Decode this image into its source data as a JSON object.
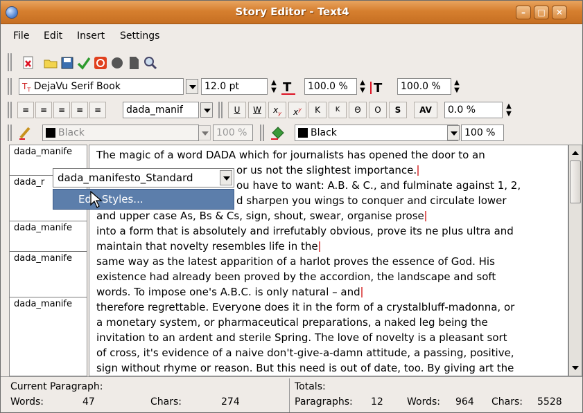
{
  "window": {
    "title": "Story Editor - Text4"
  },
  "menubar": {
    "items": [
      "File",
      "Edit",
      "Insert",
      "Settings"
    ]
  },
  "font_bar": {
    "font": "DejaVu Serif Book",
    "size": "12.0 pt",
    "scale_h": "100.0 %",
    "scale_v": "100.0 %"
  },
  "para_bar": {
    "style": "dada_manif",
    "tracking": "0.0 %"
  },
  "color_bar": {
    "stroke_color": "Black",
    "stroke_shade": "100 %",
    "fill_color": "Black",
    "fill_shade": "100 %"
  },
  "styles": [
    "dada_manife",
    "dada_r",
    "dada_manife",
    "dada_manife",
    "dada_manife"
  ],
  "dropdown": {
    "selected": "dada_manifesto_Standard",
    "menu_item": "Edit Styles..."
  },
  "text_lines": [
    "The magic of a word DADA which for journalists has opened the door to an",
    "or us not the slightest importance.",
    "ou have to want: A.B. & C., and fulminate against 1, 2,",
    "d sharpen you wings to conquer and circulate lower",
    "and upper case As, Bs & Cs, sign, shout, swear, organise prose",
    "into a form that is absolutely and irrefutably obvious, prove its ne plus ultra and",
    "maintain that novelty resembles life in the",
    "same way as the latest apparition of a harlot proves the essence of God. His",
    "existence had already been proved by the accordion, the landscape and soft",
    "words. To impose one's A.B.C. is only natural – and",
    "therefore regrettable. Everyone does it in the form of a crystalbluff-madonna, or",
    "a monetary system, or pharmaceutical preparations, a naked leg being the",
    "invitation to an ardent and sterile Spring. The love of novelty is a pleasant sort",
    "of cross, it's evidence of a naive don't-give-a-damn attitude, a passing, positive,",
    "sign without rhyme or reason. But this need is out of date, too. By giving art the"
  ],
  "status": {
    "current_paragraph_label": "Current Paragraph:",
    "words_label": "Words:",
    "words_value": "47",
    "chars_label": "Chars:",
    "chars_value": "274",
    "totals_label": "Totals:",
    "paragraphs_label": "Paragraphs:",
    "paragraphs_value": "12",
    "total_words_label": "Words:",
    "total_words_value": "964",
    "total_chars_label": "Chars:",
    "total_chars_value": "5528"
  }
}
